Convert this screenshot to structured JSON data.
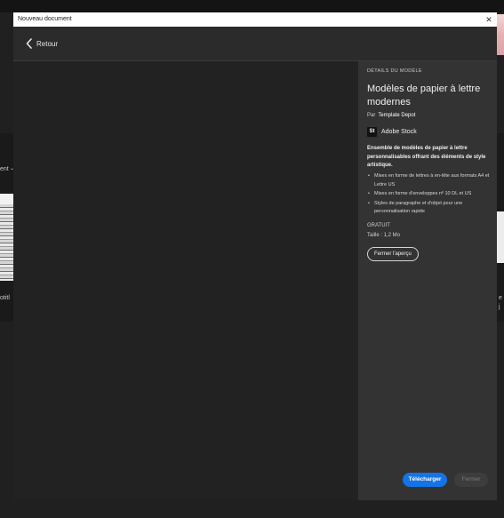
{
  "background": {
    "fragment_left_1": "ent",
    "fragment_left_2": "otitl",
    "fragment_right_1": "e",
    "fragment_right_2": "j"
  },
  "dialog": {
    "title": "Nouveau document",
    "close_icon": "close-icon"
  },
  "nav": {
    "back_label": "Retour",
    "back_icon": "chevron-left-icon"
  },
  "details": {
    "section_label": "DÉTAILS DU MODÈLE",
    "template_title": "Modèles de papier à lettre modernes",
    "by_prefix": "Par",
    "author": "Template Depot",
    "stock_logo_text": "St",
    "stock_name": "Adobe Stock",
    "description": "Ensemble de modèles de papier à lettre personnalisables offrant des éléments de style artistique.",
    "bullets": [
      "Mises en forme de lettres à en-tête aux formats A4 et Lettre US",
      "Mises en forme d'enveloppes nº 10 DL et US",
      "Styles de paragraphe et d'objet pour une personnalisation rapide"
    ],
    "price": "GRATUIT",
    "size": "Taille : 1,2 Mo",
    "close_preview_label": "Fermer l'aperçu"
  },
  "footer": {
    "download_label": "Télécharger",
    "close_label": "Fermer"
  },
  "colors": {
    "accent": "#1473e6",
    "panel": "#333333",
    "preview": "#222222"
  }
}
